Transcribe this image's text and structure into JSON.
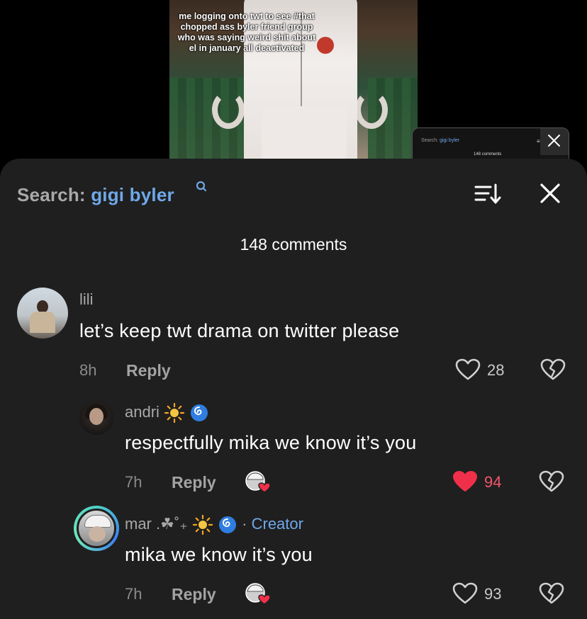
{
  "video": {
    "caption": "me logging onto twt to see #that chopped ass byler friend group who was saying weird shit about el in january all deactivated"
  },
  "mini_preview": {
    "search_prefix": "Search:",
    "search_term": "gigi byler",
    "count": "148 comments"
  },
  "header": {
    "search_prefix": "Search:",
    "search_term": "gigi byler",
    "comment_count": "148 comments"
  },
  "comments": [
    {
      "username": "lili",
      "text": "let’s keep twt drama on twitter please",
      "time": "8h",
      "reply_label": "Reply",
      "likes": "28",
      "liked": false
    },
    {
      "username": "andri",
      "text": "respectfully mika we know it’s you",
      "time": "7h",
      "reply_label": "Reply",
      "likes": "94",
      "liked": true,
      "liked_by_creator": true
    },
    {
      "username": "mar .☘˚₊",
      "badge_separator": "·",
      "badge": "Creator",
      "text": "mika we know it’s you",
      "time": "7h",
      "reply_label": "Reply",
      "likes": "93",
      "liked": false,
      "liked_by_creator": true
    }
  ],
  "colors": {
    "sheet_bg": "#1f1f1f",
    "accent_blue": "#6fa8e8",
    "like_red": "#f0576a"
  },
  "icons": {
    "sort": "sort-icon",
    "close": "close-icon",
    "heart": "heart-icon",
    "dislike": "broken-heart-icon",
    "creator_liked": "creator-liked-icon",
    "sun": "sun-emoji",
    "cyclone": "cyclone-emoji"
  }
}
